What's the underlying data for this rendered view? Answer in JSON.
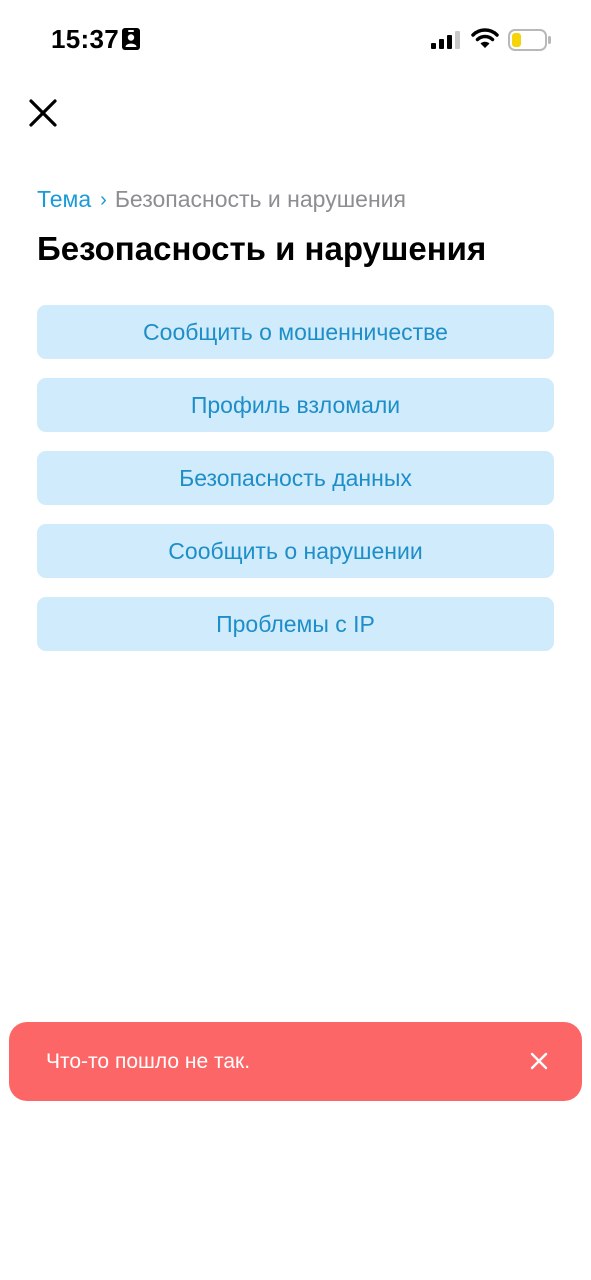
{
  "status_bar": {
    "time": "15:37"
  },
  "nav": {
    "close_icon": "close-icon"
  },
  "breadcrumb": {
    "root": "Тема",
    "separator": "›",
    "current": "Безопасность и нарушения"
  },
  "page": {
    "title": "Безопасность и нарушения"
  },
  "options": [
    {
      "label": "Сообщить о мошенничестве"
    },
    {
      "label": "Профиль взломали"
    },
    {
      "label": "Безопасность данных"
    },
    {
      "label": "Сообщить о нарушении"
    },
    {
      "label": "Проблемы с IP"
    }
  ],
  "toast": {
    "message": "Что-то пошло не так.",
    "close_icon": "close-icon"
  },
  "colors": {
    "accent": "#1a9bd7",
    "button_bg": "#d0ebfb",
    "button_text": "#1e8ec9",
    "toast_bg": "#fd6666",
    "muted": "#8d8d92"
  }
}
